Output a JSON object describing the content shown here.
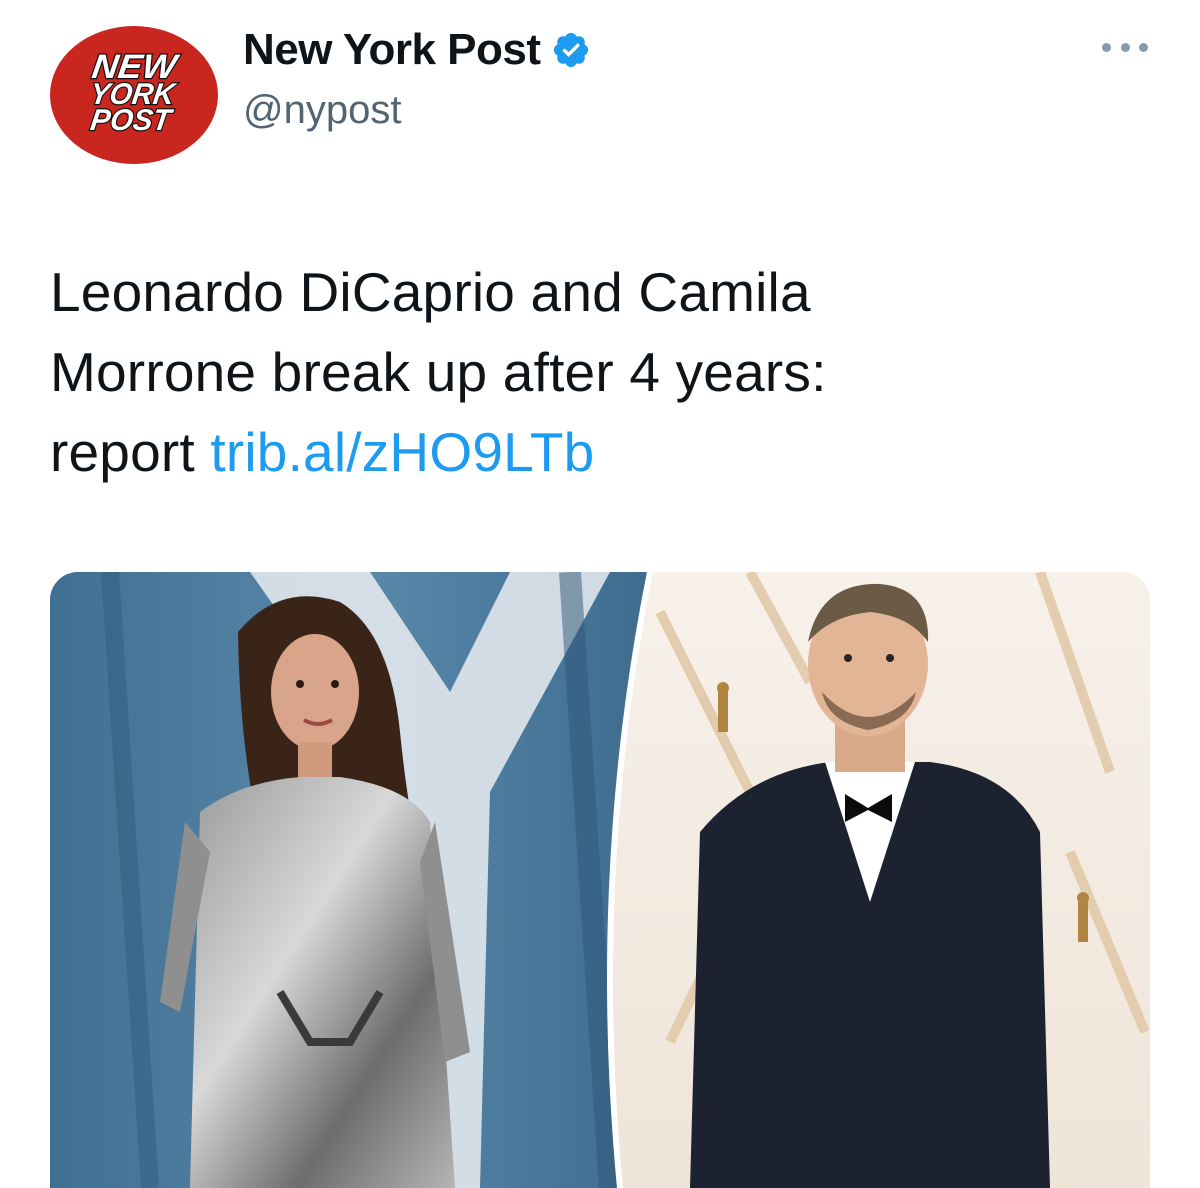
{
  "tweet": {
    "account": {
      "display_name": "New York Post",
      "handle": "@nypost",
      "verified": true,
      "avatar_logo_text": [
        "NEW",
        "YORK",
        "POST"
      ],
      "avatar_bg_color": "#c8261e"
    },
    "more_icon": "more-dots-icon",
    "text_lines": [
      "Leonardo DiCaprio and Camila",
      "Morrone break up after 4 years:",
      "report "
    ],
    "link_text": "trib.al/zHO9LTb",
    "colors": {
      "text": "#0f1419",
      "link": "#1d9bf0",
      "handle": "#536471",
      "verified_badge": "#1d9bf0"
    }
  }
}
